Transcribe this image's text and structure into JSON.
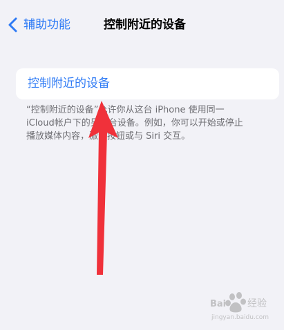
{
  "nav": {
    "back_label": "辅助功能",
    "title": "控制附近的设备"
  },
  "card": {
    "label": "控制附近的设备"
  },
  "footnote": {
    "lines": [
      "“控制附近的设备”允许你从这台 iPhone 使用同一",
      "iCloud帐户下的另一台设备。例如，你可以开始或停止",
      "播放媒体内容，激活按钮或与 Siri 交互。"
    ]
  },
  "watermark": {
    "text": "Baidu 经验",
    "url": "jingyan.baidu.com"
  },
  "icons": {
    "back": "chevron-left-icon",
    "annotation": "red-arrow-annotation"
  },
  "colors": {
    "accent": "#2f7bf5",
    "background": "#f2f2f7",
    "card": "#ffffff",
    "footnote": "#6d6d72",
    "arrow": "#f0313a"
  }
}
